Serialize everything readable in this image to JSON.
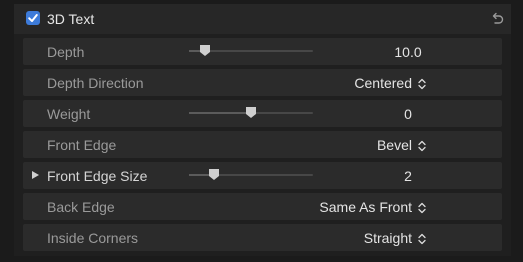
{
  "header": {
    "title": "3D Text",
    "enabled": true,
    "checkbox_color": "#3d7bd9",
    "reset_icon": "reset-arrow-icon"
  },
  "rows": [
    {
      "label": "Depth",
      "type": "slider",
      "value": "10.0",
      "slider_fraction": 0.13,
      "has_disclosure": false
    },
    {
      "label": "Depth Direction",
      "type": "popup",
      "value": "Centered"
    },
    {
      "label": "Weight",
      "type": "slider",
      "value": "0",
      "slider_fraction": 0.5,
      "has_disclosure": false
    },
    {
      "label": "Front Edge",
      "type": "popup",
      "value": "Bevel"
    },
    {
      "label": "Front Edge Size",
      "type": "slider",
      "value": "2",
      "slider_fraction": 0.2,
      "has_disclosure": true
    },
    {
      "label": "Back Edge",
      "type": "popup",
      "value": "Same As Front"
    },
    {
      "label": "Inside Corners",
      "type": "popup",
      "value": "Straight"
    }
  ]
}
